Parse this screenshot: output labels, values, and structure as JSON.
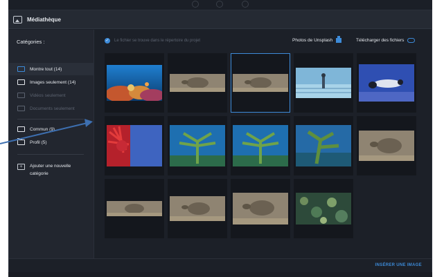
{
  "window": {
    "title": "Médiathèque"
  },
  "sidebar": {
    "heading": "Catégories :",
    "items": [
      {
        "label": "Montre tout (14)",
        "icon": "show-all-icon"
      },
      {
        "label": "Images seulement (14)",
        "icon": "image-icon"
      },
      {
        "label": "Vidéos seulement",
        "icon": "video-icon"
      },
      {
        "label": "Documents seulement",
        "icon": "document-icon"
      },
      {
        "label": "Commun (9)",
        "icon": "share-icon"
      },
      {
        "label": "Profil (5)",
        "icon": "profile-folder-icon"
      }
    ],
    "add_category": "Ajouter une nouvelle catégorie"
  },
  "toolbar": {
    "checkbox_label": "Le fichier se trouve dans le répertoire du projet",
    "unsplash_label": "Photos de Unsplash",
    "upload_label": "Télécharger des fichiers"
  },
  "footer": {
    "insert_label": "INSÉRER UNE IMAGE"
  },
  "gallery": [
    {
      "subject": "coral-reef",
      "selected": false
    },
    {
      "subject": "sea-turtle",
      "selected": false
    },
    {
      "subject": "sea-turtle",
      "selected": true
    },
    {
      "subject": "underwater-pool",
      "selected": false
    },
    {
      "subject": "diver",
      "selected": false
    },
    {
      "subject": "red-sea-fan",
      "selected": false
    },
    {
      "subject": "sea-plant",
      "selected": false
    },
    {
      "subject": "sea-plant",
      "selected": false
    },
    {
      "subject": "sea-plant",
      "selected": false
    },
    {
      "subject": "sea-turtle",
      "selected": false
    },
    {
      "subject": "sea-turtle",
      "selected": false
    },
    {
      "subject": "sea-turtle",
      "selected": false
    },
    {
      "subject": "sea-turtle",
      "selected": false
    },
    {
      "subject": "coral-bed",
      "selected": false
    }
  ],
  "colors": {
    "accent": "#3d8bd9",
    "panel": "#1c2028",
    "sidebar": "#22262f"
  }
}
